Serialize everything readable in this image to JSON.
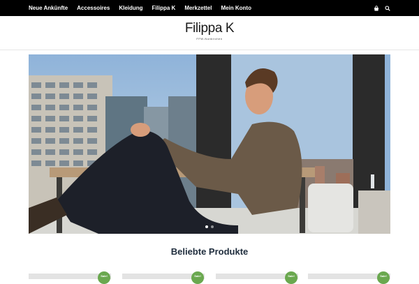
{
  "nav": {
    "items": [
      {
        "label": "Neue Ankünfte"
      },
      {
        "label": "Accessoires"
      },
      {
        "label": "Kleidung"
      },
      {
        "label": "Filippa K"
      },
      {
        "label": "Merkzettel"
      },
      {
        "label": "Mein Konto"
      }
    ],
    "icons": [
      "shopping-bag-icon",
      "search-icon"
    ]
  },
  "header": {
    "logo_name": "Filippa K",
    "logo_sub": "FFW-Nunkirchen"
  },
  "hero": {
    "description_icon": "man-sitting-in-sweater-photo",
    "slide_count": 2,
    "active_slide": 1
  },
  "popular": {
    "title": "Beliebte Produkte",
    "sale_label": "Sale!"
  },
  "colors": {
    "nav_bg": "#000000",
    "accent_green": "#6aa84f",
    "heading": "#1f2d3d"
  }
}
